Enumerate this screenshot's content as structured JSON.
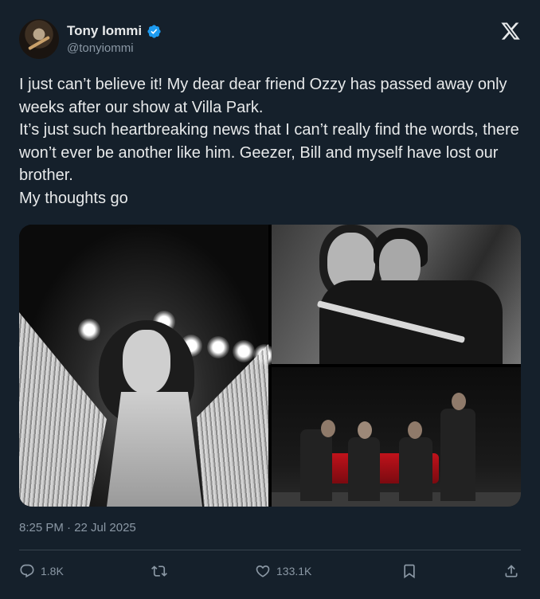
{
  "author": {
    "name": "Tony Iommi",
    "handle": "@tonyiommi",
    "verified_color": "#1d9bf0"
  },
  "tweet": {
    "text": "I just can’t believe it! My dear dear friend Ozzy has passed away only weeks after our show at Villa Park.\nIt’s just such heartbreaking news that I can’t really find the words, there won’t ever be another like him. Geezer, Bill and myself have lost our brother.\nMy thoughts go",
    "timestamp": "8:25 PM · 22 Jul 2025"
  },
  "media": {
    "images": [
      {
        "description_icon": "photo-ozzy-stage"
      },
      {
        "description_icon": "photo-ozzy-tony-embrace"
      },
      {
        "description_icon": "photo-band-group"
      }
    ]
  },
  "actions": {
    "replies": "1.8K",
    "reposts": "",
    "likes": "133.1K",
    "bookmarks": "",
    "share": ""
  },
  "icons": {
    "logo": "x-logo-icon",
    "verified": "verified-badge-icon",
    "reply": "reply-icon",
    "repost": "repost-icon",
    "like": "heart-icon",
    "bookmark": "bookmark-icon",
    "share": "share-icon"
  },
  "colors": {
    "background": "#15202b",
    "text_primary": "#e7e9ea",
    "text_secondary": "#8b98a5",
    "divider": "#38444d",
    "accent": "#1d9bf0"
  }
}
